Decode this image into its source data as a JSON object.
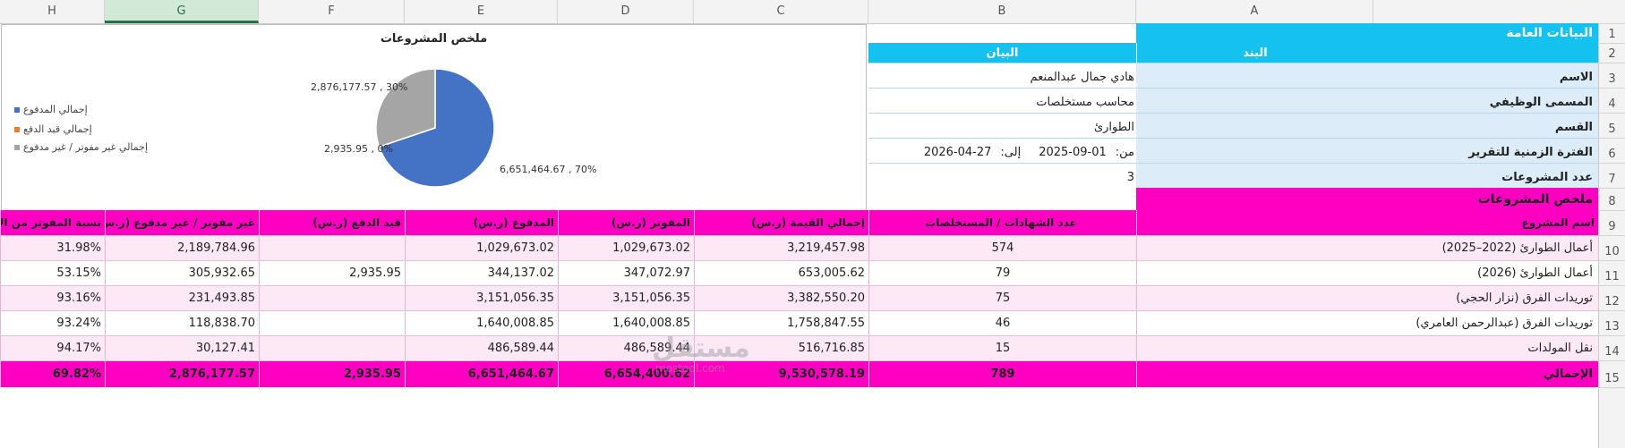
{
  "columns": [
    "H",
    "G",
    "F",
    "E",
    "D",
    "C",
    "B",
    "A"
  ],
  "rows": [
    "1",
    "2",
    "3",
    "4",
    "5",
    "6",
    "7",
    "8",
    "9",
    "10",
    "11",
    "12",
    "13",
    "14",
    "15"
  ],
  "general": {
    "title": "البيانات العامة",
    "hdr_item": "البند",
    "hdr_value": "البيان",
    "name_label": "الاسم",
    "name_value": "هادي جمال عبدالمنعم",
    "job_label": "المسمى الوظيفي",
    "job_value": "محاسب مستخلصات",
    "dept_label": "القسم",
    "dept_value": "الطوارئ",
    "period_label": "الفترة الزمنية للتقرير",
    "period_from_label": "من:",
    "period_from": "2025-09-01",
    "period_to_label": "إلى:",
    "period_to": "2026-04-27",
    "projects_count_label": "عدد المشروعات",
    "projects_count": "3",
    "summary_title": "ملخص المشروعات"
  },
  "table": {
    "headers": [
      "اسم المشروع",
      "عدد الشهادات / المستخلصات",
      "إجمالي القيمة (ر.س)",
      "المفوتر (ر.س)",
      "المدفوع (ر.س)",
      "قيد الدفع (ر.س)",
      "غير مفوتر / غير مدفوع (ر.س)",
      "نسبة المفوتر من الإجمالي"
    ],
    "rows": [
      [
        "أعمال الطوارئ (2022–2025)",
        "574",
        "3,219,457.98",
        "1,029,673.02",
        "1,029,673.02",
        "",
        "2,189,784.96",
        "31.98%"
      ],
      [
        "أعمال الطوارئ (2026)",
        "79",
        "653,005.62",
        "347,072.97",
        "344,137.02",
        "2,935.95",
        "305,932.65",
        "53.15%"
      ],
      [
        "توريدات الفرق (نزار الحجي)",
        "75",
        "3,382,550.20",
        "3,151,056.35",
        "3,151,056.35",
        "",
        "231,493.85",
        "93.16%"
      ],
      [
        "توريدات الفرق (عبدالرحمن العامري)",
        "46",
        "1,758,847.55",
        "1,640,008.85",
        "1,640,008.85",
        "",
        "118,838.70",
        "93.24%"
      ],
      [
        "نقل المولدات",
        "15",
        "516,716.85",
        "486,589.44",
        "486,589.44",
        "",
        "30,127.41",
        "94.17%"
      ]
    ],
    "total": [
      "الإجمالي",
      "789",
      "9,530,578.19",
      "6,654,400.62",
      "6,651,464.67",
      "2,935.95",
      "2,876,177.57",
      "69.82%"
    ]
  },
  "chart_data": {
    "type": "pie",
    "title": "ملخص المشروعات",
    "legend_position": "left",
    "slices": [
      {
        "name": "إجمالي المدفوع",
        "value": 6651464.67,
        "label": "6,651,464.67 , 70%",
        "color": "#4472c4"
      },
      {
        "name": "إجمالي قيد الدفع",
        "value": 2935.95,
        "label": "2,935.95 , 0%",
        "color": "#ed7d31"
      },
      {
        "name": "إجمالي غير مفوتر  /  غير مدفوع",
        "value": 2876177.57,
        "label": "2,876,177.57 , 30%",
        "color": "#a5a5a5"
      }
    ]
  },
  "watermark": {
    "main": "مستقل",
    "sub": "mostaql.com"
  }
}
